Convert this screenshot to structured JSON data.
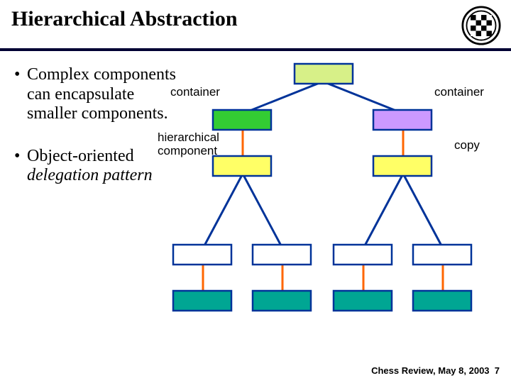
{
  "title": "Hierarchical Abstraction",
  "bullets": {
    "b1": "Complex components can encapsulate smaller components.",
    "b2a": "Object-oriented ",
    "b2b": "delegation pattern"
  },
  "labels": {
    "container_left": "container",
    "container_right": "container",
    "hier": "hierarchical component",
    "copy": "copy"
  },
  "footer": {
    "text": "Chess Review, May 8, 2003",
    "page": "7"
  },
  "colors": {
    "deepblue": "#003399",
    "black": "#000000",
    "orange": "#ff6600",
    "limeLight": "#d7f088",
    "green": "#33cc33",
    "violet": "#cc99ff",
    "yellow": "#ffff66",
    "teal": "#00a693",
    "white": "#ffffff"
  }
}
